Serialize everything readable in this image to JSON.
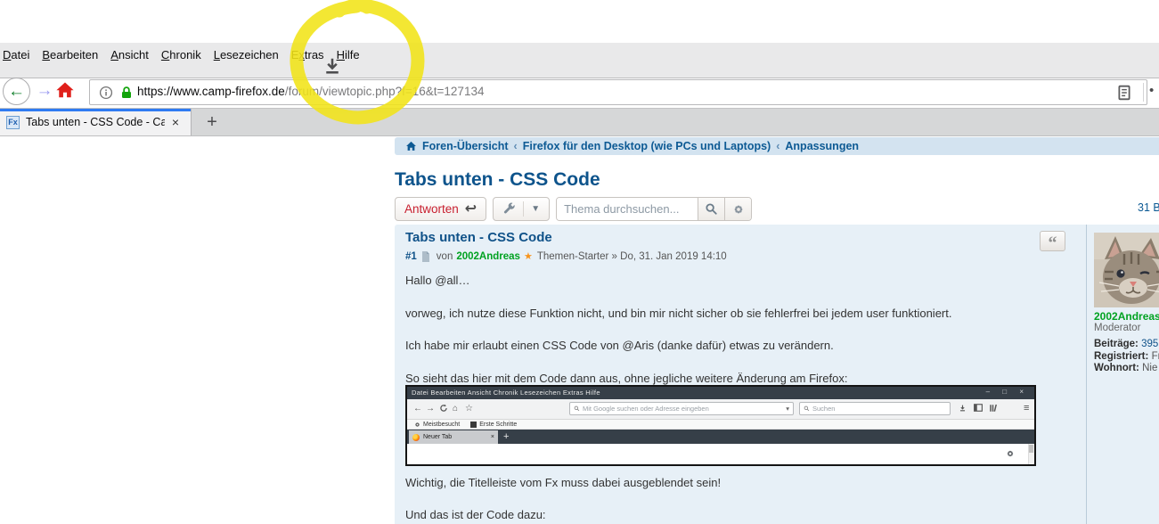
{
  "browser": {
    "menu_items": [
      {
        "pre": "",
        "key": "D",
        "post": "atei"
      },
      {
        "pre": "",
        "key": "B",
        "post": "earbeiten"
      },
      {
        "pre": "",
        "key": "A",
        "post": "nsicht"
      },
      {
        "pre": "",
        "key": "C",
        "post": "hronik"
      },
      {
        "pre": "",
        "key": "L",
        "post": "esezeichen"
      },
      {
        "pre": "E",
        "key": "x",
        "post": "tras"
      },
      {
        "pre": "",
        "key": "H",
        "post": "ilfe"
      }
    ],
    "url": {
      "secure_part": "https://www.camp-firefox.de",
      "path_part": "/forum/viewtopic.php?f=16&t=127134"
    },
    "url_dots": "•",
    "tab": {
      "favicon_text": "Fx",
      "title": "Tabs unten - CSS Code - Camp",
      "close_glyph": "×",
      "new_tab_glyph": "+"
    },
    "nav": {
      "back_glyph": "←",
      "forward_glyph": "→"
    }
  },
  "page": {
    "breadcrumb": {
      "separator": "‹",
      "items": [
        "Foren-Übersicht",
        "Firefox für den Desktop (wie PCs und Laptops)",
        "Anpassungen"
      ]
    },
    "title": "Tabs unten - CSS Code",
    "toolbar": {
      "reply_label": "Antworten",
      "reply_arrow": "↩",
      "caret": "▼",
      "search_placeholder": "Thema durchsuchen..."
    },
    "topic_count": "31 B",
    "post": {
      "title": "Tabs unten - CSS Code",
      "number": "#1",
      "byline": {
        "von": "von",
        "author": "2002Andreas",
        "star": "★",
        "rest": "Themen-Starter » Do, 31. Jan 2019 14:10"
      },
      "quote_glyph": "“",
      "paragraphs": [
        "Hallo @all…",
        "vorweg, ich nutze diese Funktion nicht, und bin mir nicht sicher ob sie fehlerfrei bei jedem user funktioniert.",
        "Ich habe mir erlaubt einen CSS Code von @Aris (danke dafür) etwas zu verändern.",
        "So sieht das hier mit dem Code dann aus, ohne jegliche weitere Änderung am Firefox:",
        "Wichtig, die Titelleiste vom Fx muss dabei ausgeblendet sein!",
        "Und das ist der Code dazu:"
      ],
      "screenshot": {
        "menubar": "Datei  Bearbeiten  Ansicht  Chronik  Lesezeichen  Extras  Hilfe",
        "window_controls": "–  □  ×",
        "back_glyph": "←",
        "forward_glyph": "→",
        "home_glyph": "⌂",
        "bookmark_glyph": "☆",
        "urlbar_placeholder": "Mit Google suchen oder Adresse eingeben",
        "urlbar_caret": "▾",
        "search_placeholder": "Suchen",
        "hamburger_glyph": "≡",
        "bookmarks_item1": "Meistbesucht",
        "bookmarks_item2": "Erste Schritte",
        "tab_title": "Neuer Tab",
        "tab_close": "×",
        "new_tab_glyph": "+"
      }
    },
    "profile": {
      "name": "2002Andreas",
      "rank": "Moderator",
      "fields": [
        {
          "label": "Beiträge:",
          "value": "395"
        },
        {
          "label": "Registriert:",
          "value": "Fr"
        },
        {
          "label": "Wohnort:",
          "value": "Nie"
        }
      ]
    }
  },
  "colors": {
    "accent_link_blue": "#105289",
    "breadcrumb_bg": "#d3e3f0",
    "post_bg": "#e7f0f7",
    "author_green": "#00a221",
    "star_orange": "#f7941d",
    "reply_red": "#c81e2e",
    "active_tab_stripe": "#2f7bf2",
    "padlock_green": "#12a40b",
    "highlighter_yellow": "#f2e418",
    "dark_titlebar": "#363f48"
  }
}
